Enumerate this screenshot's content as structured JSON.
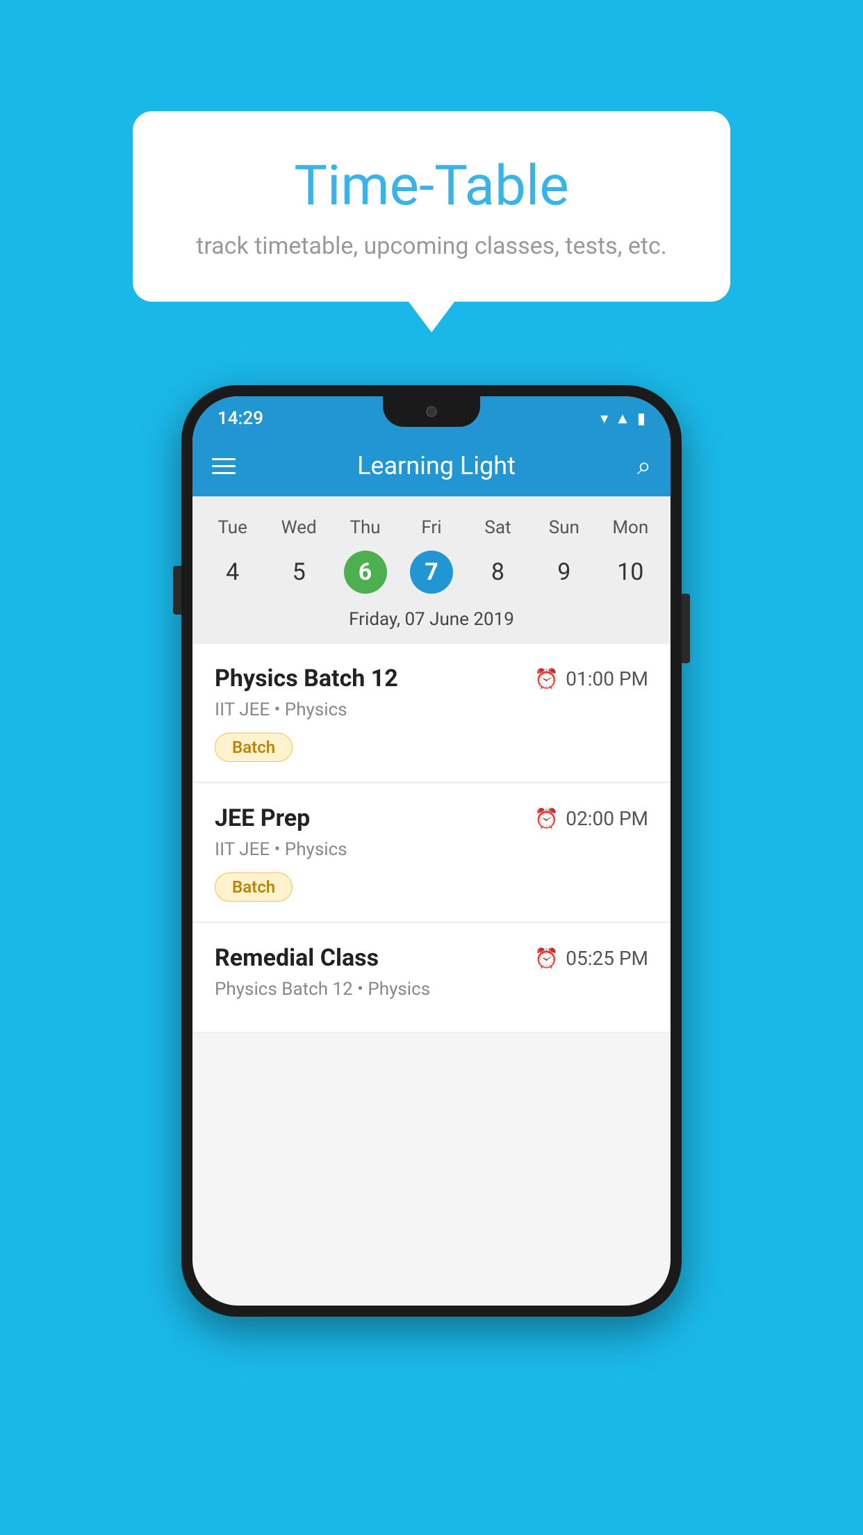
{
  "background_color": "#1ab8e8",
  "bubble": {
    "title": "Time-Table",
    "subtitle": "track timetable, upcoming classes, tests, etc."
  },
  "phone": {
    "status_bar": {
      "time": "14:29"
    },
    "app_bar": {
      "title": "Learning Light"
    },
    "calendar": {
      "days": [
        "Tue",
        "Wed",
        "Thu",
        "Fri",
        "Sat",
        "Sun",
        "Mon"
      ],
      "numbers": [
        "4",
        "5",
        "6",
        "7",
        "8",
        "9",
        "10"
      ],
      "today_index": 2,
      "selected_index": 3,
      "selected_date_label": "Friday, 07 June 2019"
    },
    "classes": [
      {
        "name": "Physics Batch 12",
        "time": "01:00 PM",
        "detail": "IIT JEE • Physics",
        "badge": "Batch"
      },
      {
        "name": "JEE Prep",
        "time": "02:00 PM",
        "detail": "IIT JEE • Physics",
        "badge": "Batch"
      },
      {
        "name": "Remedial Class",
        "time": "05:25 PM",
        "detail": "Physics Batch 12 • Physics",
        "badge": ""
      }
    ]
  }
}
